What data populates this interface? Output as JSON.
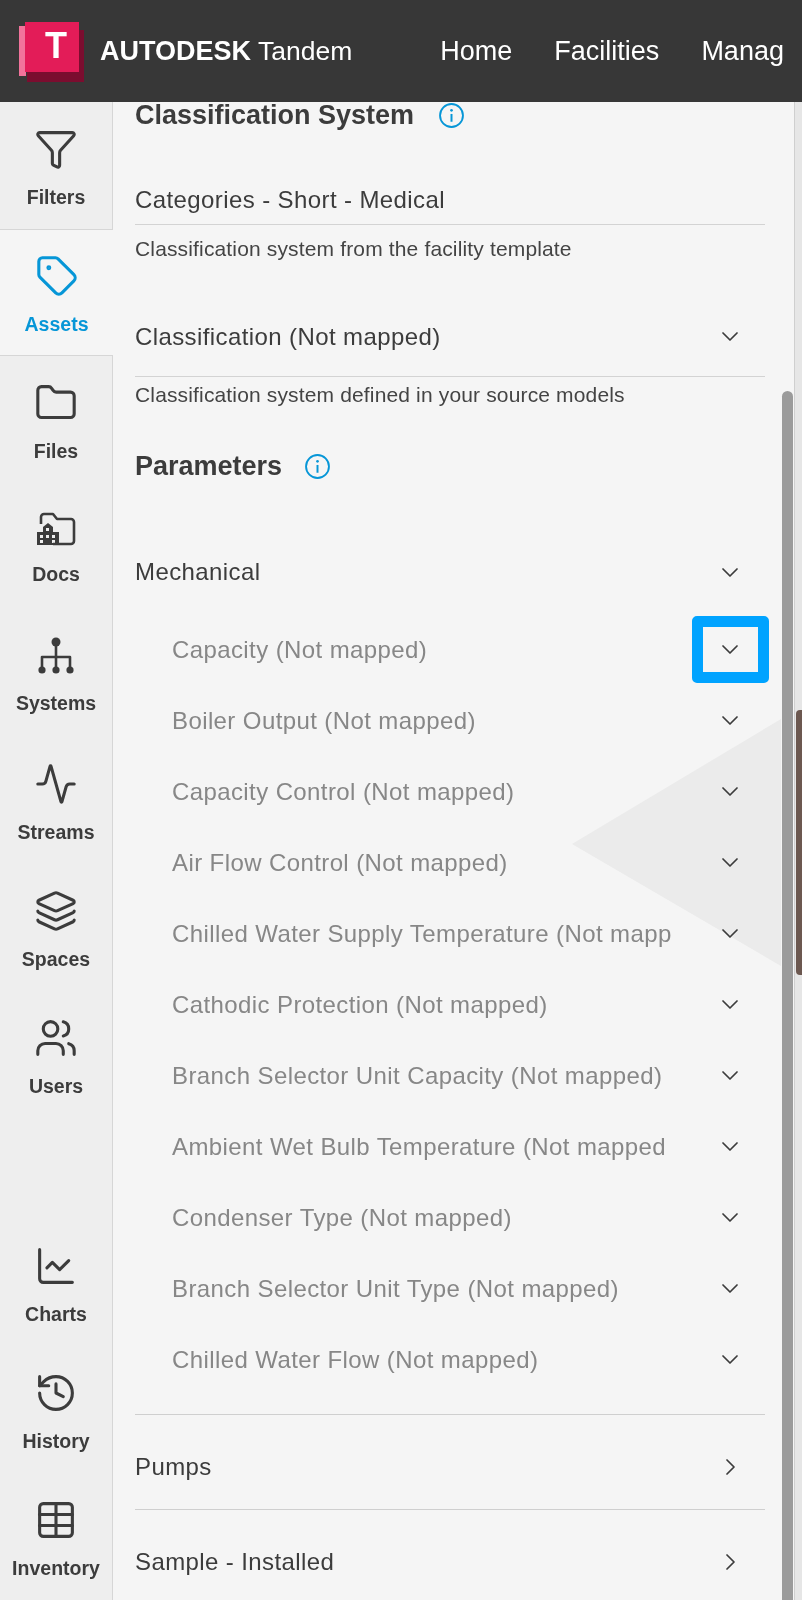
{
  "header": {
    "logo_letter": "T",
    "brand": "AUTODESK",
    "product": "Tandem",
    "nav": [
      "Home",
      "Facilities",
      "Manag"
    ]
  },
  "sidebar": {
    "items": [
      {
        "label": "Filters",
        "selected": false
      },
      {
        "label": "Assets",
        "selected": true
      },
      {
        "label": "Files",
        "selected": false
      },
      {
        "label": "Docs",
        "selected": false
      },
      {
        "label": "Systems",
        "selected": false
      },
      {
        "label": "Streams",
        "selected": false
      },
      {
        "label": "Spaces",
        "selected": false
      },
      {
        "label": "Users",
        "selected": false
      }
    ],
    "bottom_items": [
      {
        "label": "Charts",
        "selected": false
      },
      {
        "label": "History",
        "selected": false
      },
      {
        "label": "Inventory",
        "selected": false
      }
    ]
  },
  "classification": {
    "title": "Classification System",
    "fields": [
      {
        "kind": "text",
        "value": "Categories - Short - Medical",
        "hint": "Classification system from the facility template"
      },
      {
        "kind": "select",
        "value": "Classification (Not mapped)",
        "hint": "Classification system defined in your source models"
      }
    ]
  },
  "parameters": {
    "title": "Parameters",
    "groups": [
      {
        "label": "Mechanical",
        "expanded": true,
        "children": [
          {
            "label": "Capacity (Not mapped)",
            "focused": true
          },
          {
            "label": "Boiler Output (Not mapped)",
            "focused": false
          },
          {
            "label": "Capacity Control (Not mapped)",
            "focused": false
          },
          {
            "label": "Air Flow Control (Not mapped)",
            "focused": false
          },
          {
            "label": "Chilled Water Supply Temperature (Not mapp",
            "focused": false
          },
          {
            "label": "Cathodic Protection (Not mapped)",
            "focused": false
          },
          {
            "label": "Branch Selector Unit Capacity (Not mapped)",
            "focused": false
          },
          {
            "label": "Ambient Wet Bulb Temperature (Not mapped",
            "focused": false
          },
          {
            "label": "Condenser Type (Not mapped)",
            "focused": false
          },
          {
            "label": "Branch Selector Unit Type (Not mapped)",
            "focused": false
          },
          {
            "label": "Chilled Water Flow (Not mapped)",
            "focused": false
          }
        ]
      },
      {
        "label": "Pumps",
        "expanded": false
      },
      {
        "label": "Sample - Installed",
        "expanded": false
      }
    ]
  }
}
